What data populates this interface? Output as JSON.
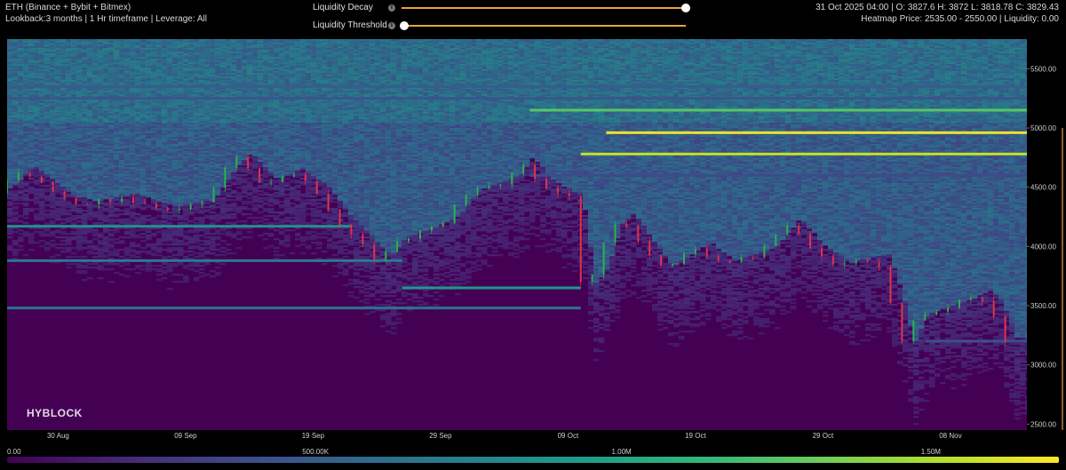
{
  "header": {
    "title": "ETH (Binance + Bybit + Bitmex)",
    "subtitle": "Lookback:3 months | 1 Hr timeframe | Leverage: All",
    "ohlc": "31 Oct 2025 04:00 | O: 3827.6 H: 3872 L: 3818.78 C: 3829.43",
    "heatmap_info": "Heatmap Price: 2535.00 - 2550.00 | Liquidity: 0.00"
  },
  "controls": {
    "decay_label": "Liquidity Decay",
    "decay_value": 1.0,
    "threshold_label": "Liquidity Threshold",
    "threshold_value": 0.0
  },
  "watermark": "HYBLOCK",
  "colors": {
    "background": "#000000",
    "up": "#2bb24c",
    "down": "#e0324b",
    "slider": "#e8a33a",
    "colormap": [
      "#440154",
      "#482878",
      "#3e4a89",
      "#31688e",
      "#26828e",
      "#1f9e89",
      "#35b779",
      "#6ece58",
      "#b5de2b",
      "#fde725"
    ]
  },
  "colorbar": {
    "labels": [
      "0.00",
      "500.00K",
      "1.00M",
      "1.50M"
    ],
    "values": [
      0,
      500000,
      1000000,
      1500000
    ],
    "max": 1700000
  },
  "chart_data": {
    "type": "heatmap",
    "overlay": "candlestick",
    "x_tick_labels": [
      "30 Aug",
      "09 Sep",
      "19 Sep",
      "29 Sep",
      "09 Oct",
      "19 Oct",
      "29 Oct",
      "08 Nov"
    ],
    "x_start": "2025-08-26",
    "x_end": "2025-11-14",
    "y_tick_labels": [
      "5500.00",
      "5000.00",
      "4500.00",
      "4000.00",
      "3500.00",
      "3000.00",
      "2500.00"
    ],
    "y_ticks": [
      5500,
      5000,
      4500,
      4000,
      3500,
      3000,
      2500
    ],
    "ylim": [
      2450,
      5750
    ],
    "current_price": 5000,
    "price_path": [
      {
        "date": "2025-08-26",
        "price": 4450
      },
      {
        "date": "2025-08-28",
        "price": 4650
      },
      {
        "date": "2025-08-31",
        "price": 4400
      },
      {
        "date": "2025-09-02",
        "price": 4350
      },
      {
        "date": "2025-09-05",
        "price": 4420
      },
      {
        "date": "2025-09-08",
        "price": 4300
      },
      {
        "date": "2025-09-11",
        "price": 4360
      },
      {
        "date": "2025-09-13",
        "price": 4650
      },
      {
        "date": "2025-09-14",
        "price": 4760
      },
      {
        "date": "2025-09-16",
        "price": 4530
      },
      {
        "date": "2025-09-18",
        "price": 4620
      },
      {
        "date": "2025-09-20",
        "price": 4480
      },
      {
        "date": "2025-09-22",
        "price": 4200
      },
      {
        "date": "2025-09-25",
        "price": 3880
      },
      {
        "date": "2025-09-26",
        "price": 4030
      },
      {
        "date": "2025-09-30",
        "price": 4200
      },
      {
        "date": "2025-10-02",
        "price": 4450
      },
      {
        "date": "2025-10-05",
        "price": 4550
      },
      {
        "date": "2025-10-06",
        "price": 4720
      },
      {
        "date": "2025-10-08",
        "price": 4500
      },
      {
        "date": "2025-10-10",
        "price": 4400
      },
      {
        "date": "2025-10-11",
        "price": 3650
      },
      {
        "date": "2025-10-12",
        "price": 3800
      },
      {
        "date": "2025-10-13",
        "price": 4150
      },
      {
        "date": "2025-10-14",
        "price": 4250
      },
      {
        "date": "2025-10-17",
        "price": 3800
      },
      {
        "date": "2025-10-20",
        "price": 4000
      },
      {
        "date": "2025-10-22",
        "price": 3850
      },
      {
        "date": "2025-10-25",
        "price": 3950
      },
      {
        "date": "2025-10-27",
        "price": 4200
      },
      {
        "date": "2025-10-29",
        "price": 3980
      },
      {
        "date": "2025-10-31",
        "price": 3830
      },
      {
        "date": "2025-11-03",
        "price": 3900
      },
      {
        "date": "2025-11-04",
        "price": 3600
      },
      {
        "date": "2025-11-05",
        "price": 3150
      },
      {
        "date": "2025-11-06",
        "price": 3400
      },
      {
        "date": "2025-11-09",
        "price": 3500
      },
      {
        "date": "2025-11-11",
        "price": 3600
      },
      {
        "date": "2025-11-12",
        "price": 3480
      },
      {
        "date": "2025-11-13",
        "price": 3200
      },
      {
        "date": "2025-11-14",
        "price": 3200
      }
    ],
    "liquidity_bands": [
      {
        "price": 5150,
        "start": "2025-10-06",
        "end": "2025-11-14",
        "value": 1250000
      },
      {
        "price": 4960,
        "start": "2025-10-12",
        "end": "2025-11-14",
        "value": 1650000
      },
      {
        "price": 4780,
        "start": "2025-10-10",
        "end": "2025-11-14",
        "value": 1550000
      },
      {
        "price": 4170,
        "start": "2025-08-26",
        "end": "2025-09-22",
        "value": 850000
      },
      {
        "price": 3880,
        "start": "2025-08-26",
        "end": "2025-09-26",
        "value": 700000
      },
      {
        "price": 3650,
        "start": "2025-09-26",
        "end": "2025-10-10",
        "value": 900000
      },
      {
        "price": 3480,
        "start": "2025-08-26",
        "end": "2025-10-10",
        "value": 650000
      },
      {
        "price": 5350,
        "start": "2025-08-26",
        "end": "2025-11-14",
        "value": 500000
      },
      {
        "price": 5250,
        "start": "2025-08-26",
        "end": "2025-11-14",
        "value": 450000
      },
      {
        "price": 4600,
        "start": "2025-10-06",
        "end": "2025-11-14",
        "value": 380000
      },
      {
        "price": 3200,
        "start": "2025-11-06",
        "end": "2025-11-14",
        "value": 420000
      }
    ]
  }
}
